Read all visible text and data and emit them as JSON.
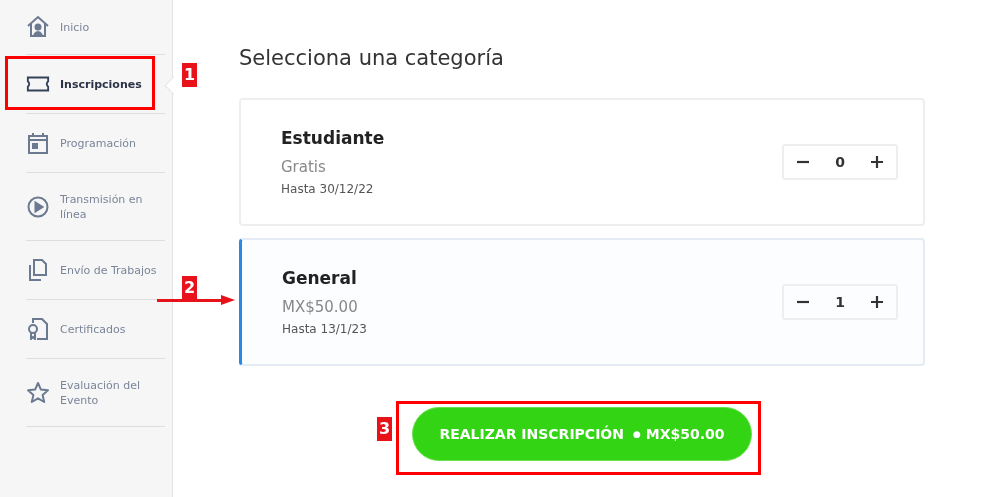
{
  "sidebar": {
    "items": [
      {
        "label": "Inicio",
        "kind": "home",
        "selected": false
      },
      {
        "label": "Inscripciones",
        "kind": "ticket",
        "selected": true
      },
      {
        "label": "Programación",
        "kind": "calendar",
        "selected": false
      },
      {
        "label": "Transmisión en línea",
        "kind": "play",
        "selected": false
      },
      {
        "label": "Envío de Trabajos",
        "kind": "files",
        "selected": false
      },
      {
        "label": "Certificados",
        "kind": "certificate",
        "selected": false
      },
      {
        "label": "Evaluación del Evento",
        "kind": "star",
        "selected": false
      }
    ]
  },
  "main": {
    "title": "Selecciona una categoría",
    "categories": [
      {
        "name": "Estudiante",
        "price": "Gratis",
        "deadline": "Hasta 30/12/22",
        "quantity": "0",
        "selected": false
      },
      {
        "name": "General",
        "price": "MX$50.00",
        "deadline": "Hasta 13/1/23",
        "quantity": "1",
        "selected": true
      }
    ],
    "submit": {
      "label": "REALIZAR INSCRIPCIÓN",
      "separator": "●",
      "price": "MX$50.00"
    }
  },
  "annotations": [
    {
      "number": "1",
      "kind": "box"
    },
    {
      "number": "2",
      "kind": "arrow"
    },
    {
      "number": "3",
      "kind": "box"
    }
  ]
}
